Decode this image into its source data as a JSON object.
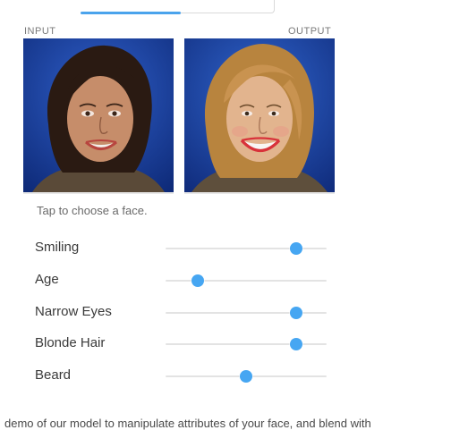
{
  "captions": {
    "input": "INPUT",
    "output": "OUTPUT"
  },
  "hint": "Tap to choose a face.",
  "sliders": [
    {
      "label": "Smiling",
      "value": 0.81
    },
    {
      "label": "Age",
      "value": 0.2
    },
    {
      "label": "Narrow Eyes",
      "value": 0.81
    },
    {
      "label": "Blonde Hair",
      "value": 0.81
    },
    {
      "label": "Beard",
      "value": 0.5
    }
  ],
  "footer": "demo of our model to manipulate attributes of your face, and blend with",
  "colors": {
    "accent": "#46a6f2",
    "track": "#e3e3e3",
    "photo_background": "#163a94"
  }
}
